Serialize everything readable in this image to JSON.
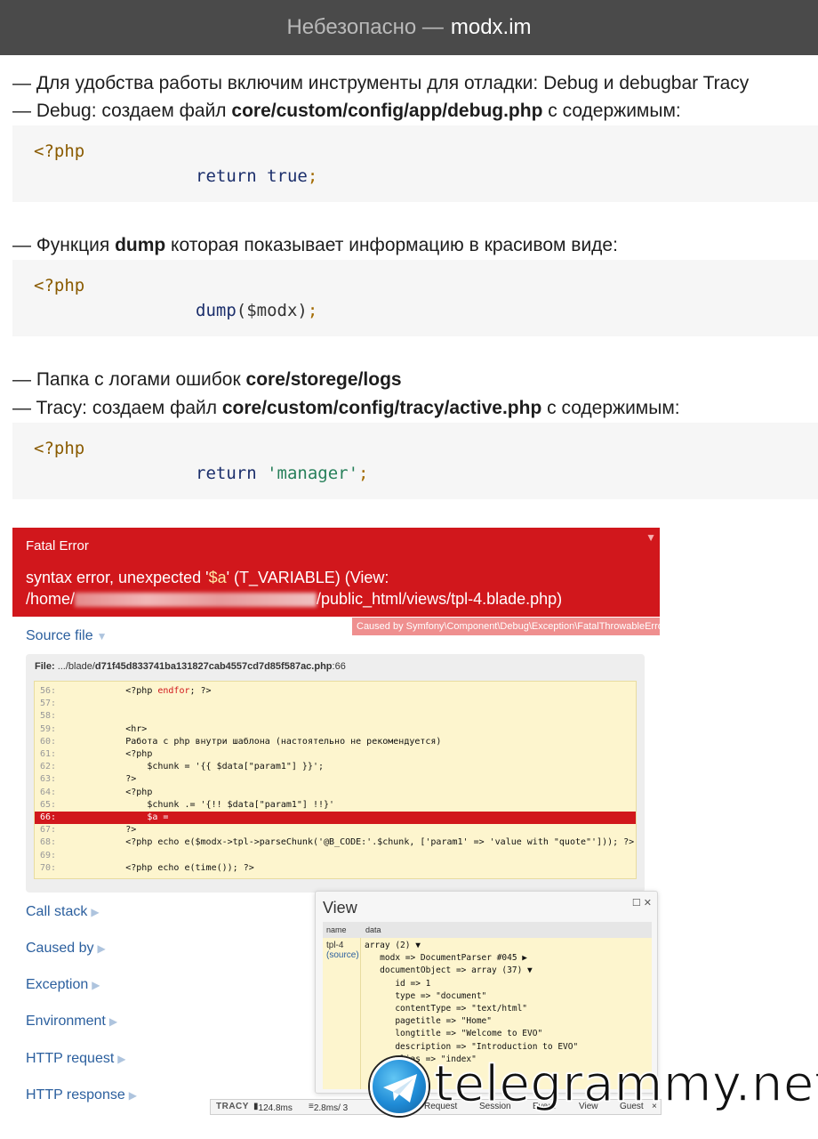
{
  "browser": {
    "insecure_label": "Небезопасно —",
    "domain": "modx.im"
  },
  "article": {
    "line1": "— Для удобства работы включим инструменты для отладки: Debug и debugbar Tracy",
    "line2_prefix": "— Debug: создаем файл ",
    "line2_path": "core/custom/config/app/debug.php",
    "line2_suffix": " с содержимым:",
    "code1": {
      "open": "<?php",
      "kw": "return",
      "val": "true",
      "semi": ";"
    },
    "line3_prefix": "— Функция ",
    "line3_bold": "dump",
    "line3_suffix": " которая показывает информацию в красивом виде:",
    "code2": {
      "open": "<?php",
      "fn": "dump",
      "arg": "($modx)",
      "semi": ";"
    },
    "line4_prefix": "— Папка с логами ошибок ",
    "line4_bold": "core/storege/logs",
    "line5_prefix": "— Tracy: создаем файл ",
    "line5_path": "core/custom/config/tracy/active.php",
    "line5_suffix": " с содержимым:",
    "code3": {
      "open": "<?php",
      "kw": "return",
      "val": "'manager'",
      "semi": ";"
    }
  },
  "tracy": {
    "error_title": "Fatal Error",
    "msg_a": "syntax error, unexpected '",
    "msg_hl": "$a",
    "msg_b": "' (T_VARIABLE) (View:",
    "msg_path_a": "/home/",
    "msg_path_b": "/public_html/views/tpl-4.blade.php)",
    "caused_by_tag": "Caused by Symfony\\Component\\Debug\\Exception\\FatalThrowableError",
    "source_file": "Source file",
    "file_label": "File:",
    "file_dir": ".../blade/",
    "file_name": "d71f45d833741ba131827cab4557cd7d85f587ac.php",
    "file_line": ":66",
    "sections": [
      "Call stack",
      "Caused by",
      "Exception",
      "Environment",
      "HTTP request",
      "HTTP response"
    ],
    "code_lines": [
      {
        "n": "56:",
        "t": "            <?php ",
        "k": "endfor",
        "r": "; ?>"
      },
      {
        "n": "57:",
        "t": ""
      },
      {
        "n": "58:",
        "t": ""
      },
      {
        "n": "59:",
        "t": "            <hr>"
      },
      {
        "n": "60:",
        "t": "            Работа с php внутри шаблона (настоятельно не рекомендуется)"
      },
      {
        "n": "61:",
        "t": "            <?php"
      },
      {
        "n": "62:",
        "t": "                $chunk = '{{ $data[\"param1\"] }}';"
      },
      {
        "n": "63:",
        "t": "            ?>"
      },
      {
        "n": "64:",
        "t": "            <?php"
      },
      {
        "n": "65:",
        "t": "                $chunk .= '{!! $data[\"param1\"] !!}'"
      },
      {
        "n": "66:",
        "t": "                $a ="
      },
      {
        "n": "67:",
        "t": "            ?>"
      },
      {
        "n": "68:",
        "t": "            <?php echo e($modx->tpl->parseChunk('@B_CODE:'.$chunk, ['param1' => 'value with \"quote\"'])); ?>"
      },
      {
        "n": "69:",
        "t": ""
      },
      {
        "n": "70:",
        "t": "            <?php echo e(time()); ?>"
      }
    ],
    "view_panel": {
      "title": "View",
      "controls": "☐ ✕",
      "col_name": "name",
      "col_data": "data",
      "var_name": "tpl-4",
      "source_link": "(source)",
      "rows": [
        "array (2) ▼",
        "   modx => DocumentParser #045 ▶",
        "   documentObject => array (37) ▼",
        "      id => 1",
        "      type => \"document\"",
        "      contentType => \"text/html\"",
        "      pagetitle => \"Home\"",
        "      longtitle => \"Welcome to EVO\"",
        "      description => \"Introduction to EVO\"",
        "      alias => \"index\""
      ]
    },
    "bar": {
      "logo": "TRACY",
      "time": "124.8ms",
      "db": "2.8ms/ 3",
      "request": "Request",
      "session": "Session",
      "event": "Event",
      "view": "View",
      "guest": "Guest",
      "close": "×"
    }
  },
  "watermark": "telegrammy.net"
}
